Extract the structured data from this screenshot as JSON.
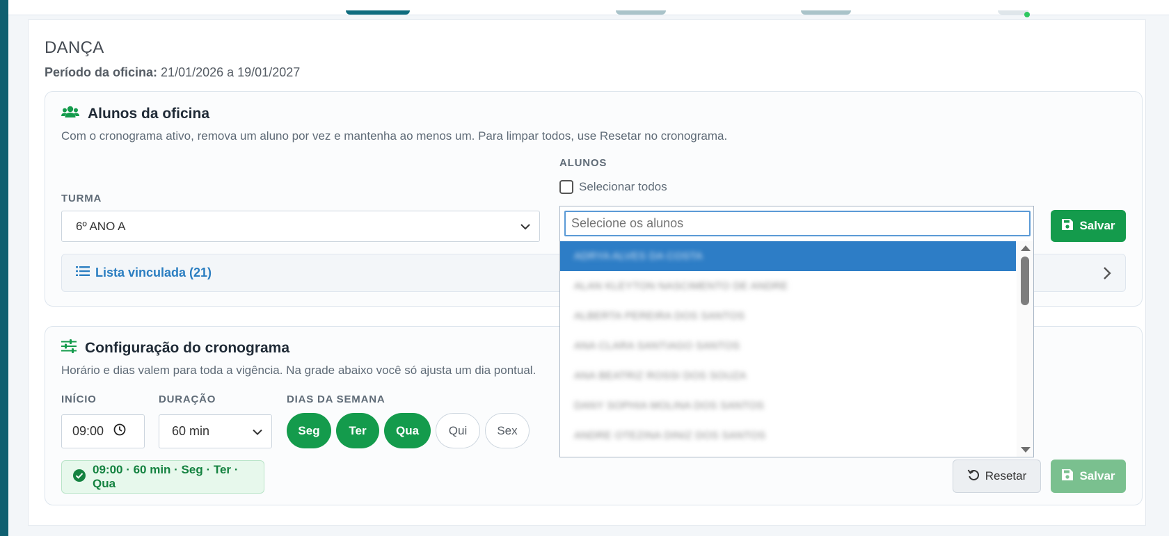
{
  "header": {
    "title": "DANÇA",
    "period_label": "Período da oficina:",
    "period_value": "21/01/2026 a 19/01/2027"
  },
  "students_section": {
    "title": "Alunos da oficina",
    "description": "Com o cronograma ativo, remova um aluno por vez e mantenha ao menos um.  Para limpar todos, use Resetar no cronograma.",
    "turma_label": "TURMA",
    "turma_value": "6º ANO A",
    "alunos_label": "ALUNOS",
    "select_all_label": "Selecionar todos",
    "search_placeholder": "Selecione os alunos",
    "options": [
      "ADRYA ALVES DA COSTA",
      "ALAN KLEYTON NASCIMENTO DE ANDRE",
      "ALBERTA PEREIRA DOS SANTOS",
      "ANA CLARA SANTIAGO SANTOS",
      "ANA BEATRIZ ROSSI DOS SOUZA",
      "DANY SOPHIA MOLINA DOS SANTOS",
      "ANDRE OTEZINA DINIZ DOS SANTOS"
    ],
    "save_label": "Salvar",
    "linked_list_label": "Lista vinculada (21)"
  },
  "schedule_section": {
    "title": "Configuração do cronograma",
    "description": "Horário e dias valem para toda a vigência. Na grade abaixo você só ajusta um dia pontual.",
    "start_label": "INÍCIO",
    "start_value": "09:00",
    "duration_label": "DURAÇÃO",
    "duration_value": "60 min",
    "weekdays_label": "DIAS DA SEMANA",
    "days": [
      {
        "label": "Seg",
        "active": true
      },
      {
        "label": "Ter",
        "active": true
      },
      {
        "label": "Qua",
        "active": true
      },
      {
        "label": "Qui",
        "active": false
      },
      {
        "label": "Sex",
        "active": false
      }
    ],
    "summary": "09:00 · 60 min · Seg · Ter · Qua",
    "reset_label": "Resetar",
    "save_label": "Salvar"
  },
  "colors": {
    "accent_green": "#149b4c",
    "link_blue": "#2b7ec1",
    "selected_option": "#2d7dc6"
  }
}
